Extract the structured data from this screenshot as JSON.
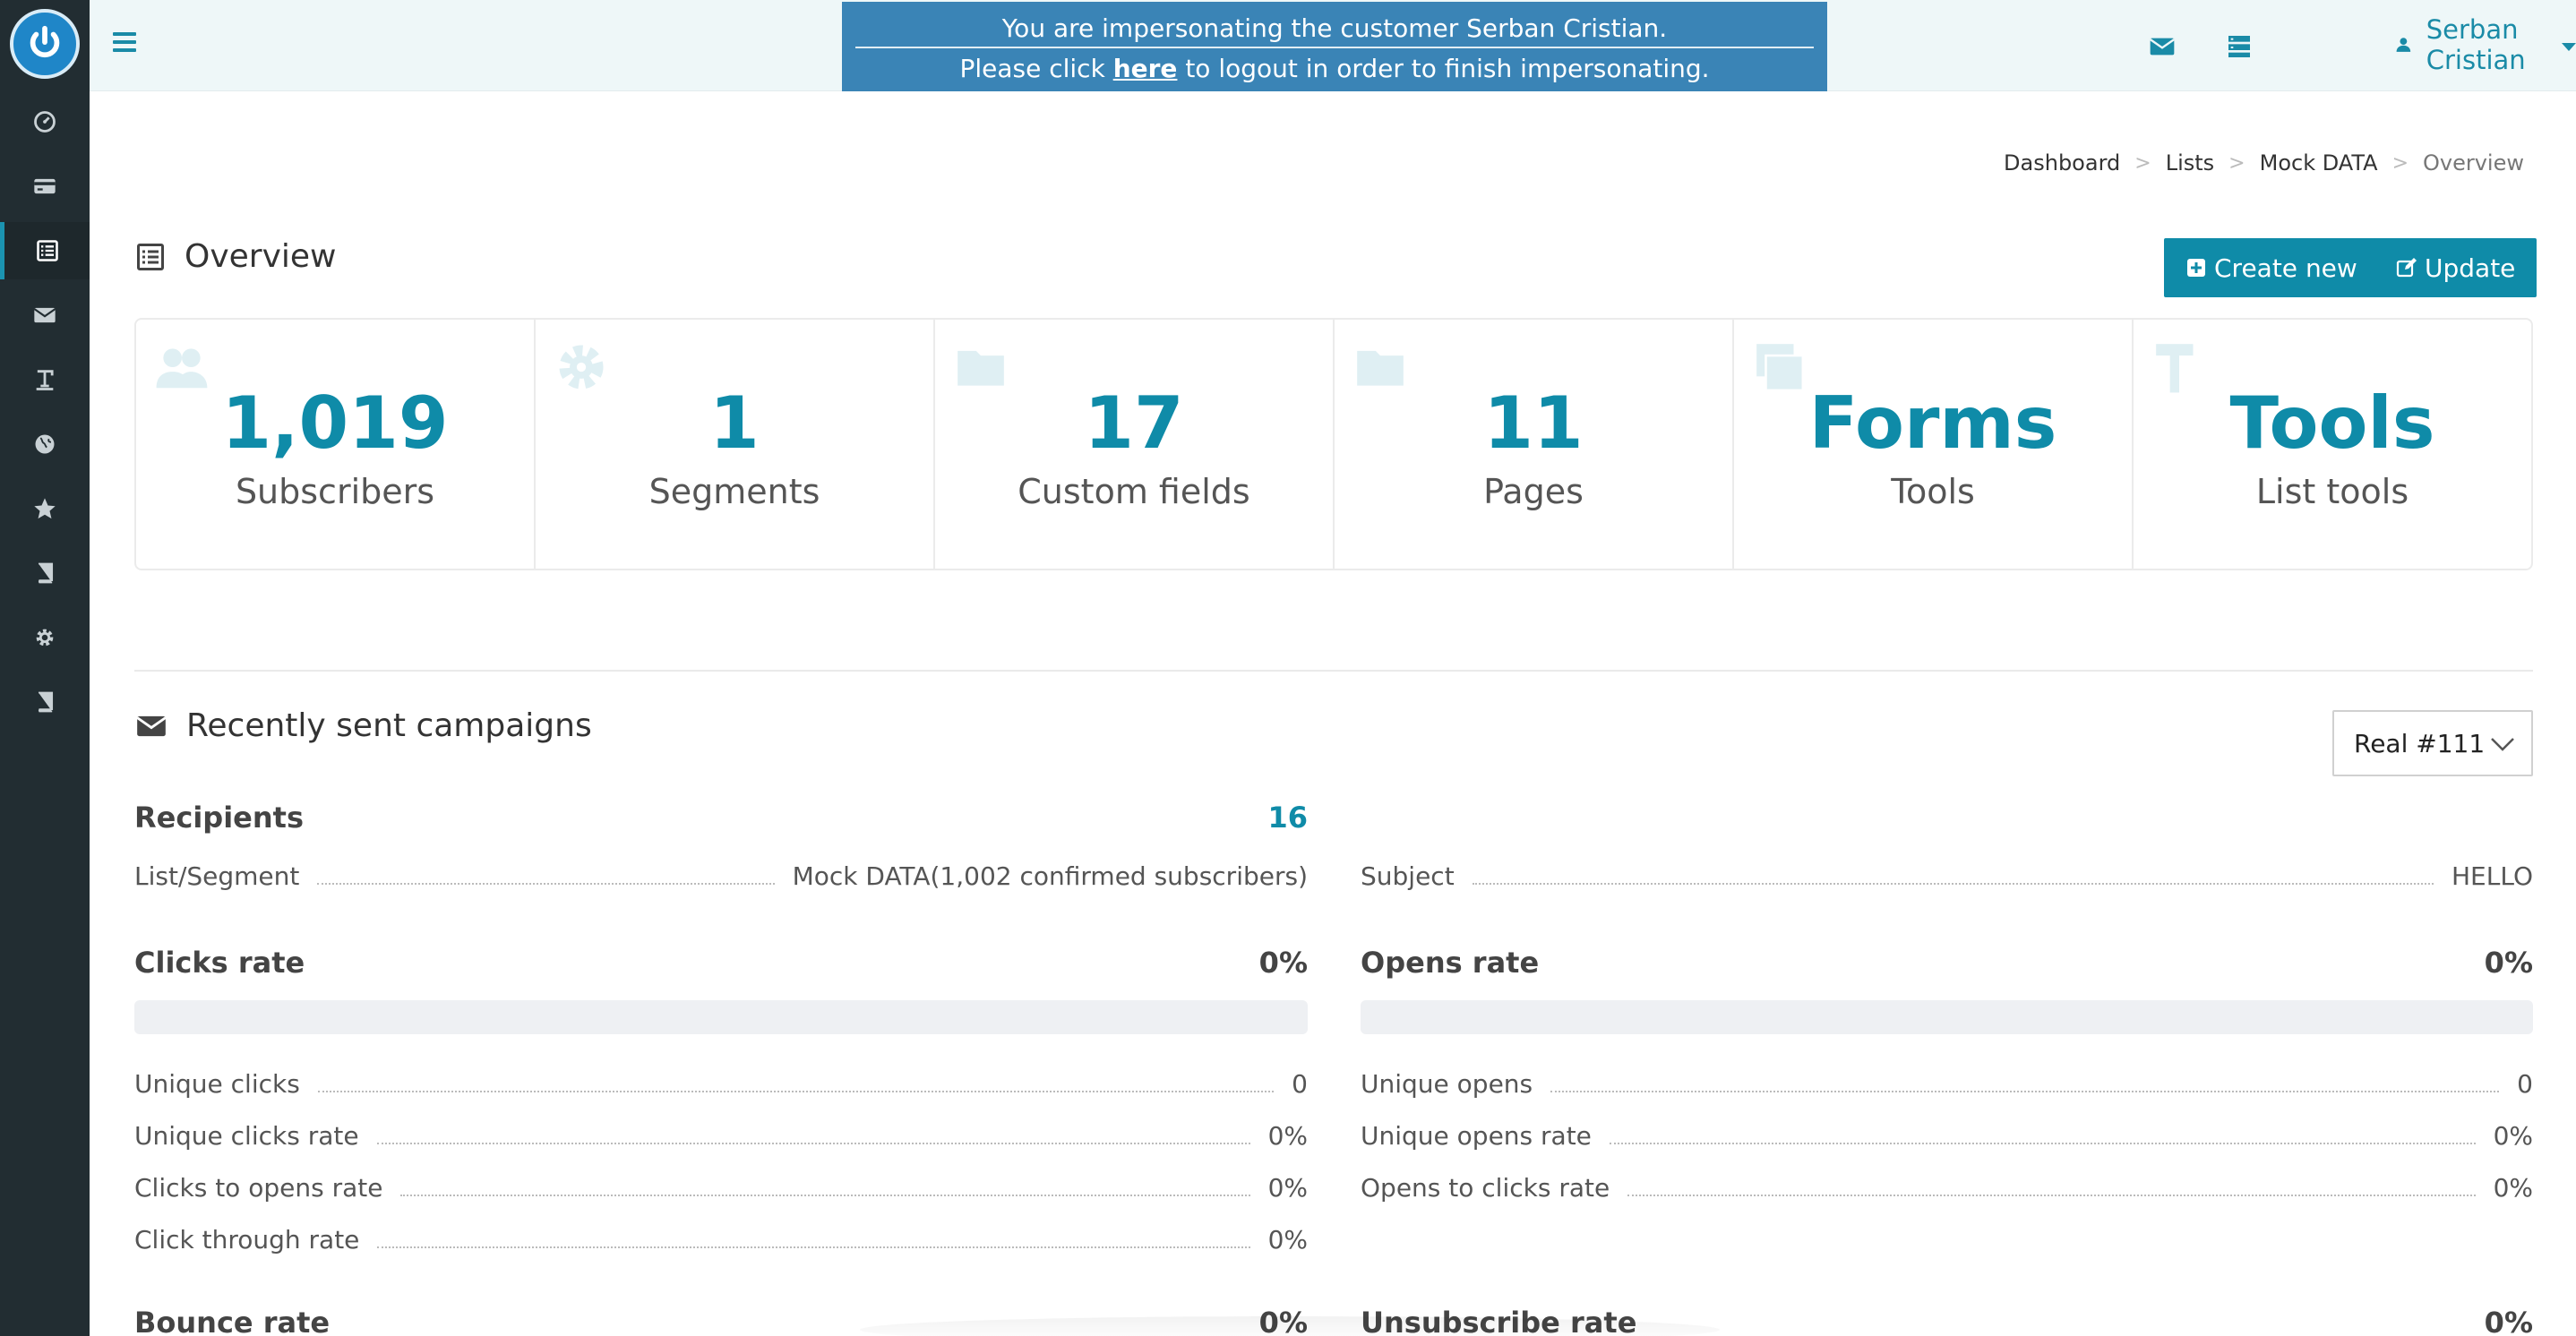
{
  "impersonation": {
    "line1": "You are impersonating the customer Serban Cristian.",
    "line2_pre": "Please click ",
    "line2_link": "here",
    "line2_post": " to logout in order to finish impersonating."
  },
  "header": {
    "user_name": "Serban Cristian"
  },
  "sidebar": {
    "items": [
      {
        "icon": "dashboard-icon"
      },
      {
        "icon": "credit-card-icon"
      },
      {
        "icon": "list-icon",
        "active": true
      },
      {
        "icon": "envelope-icon"
      },
      {
        "icon": "text-icon"
      },
      {
        "icon": "globe-icon"
      },
      {
        "icon": "star-icon"
      },
      {
        "icon": "book-icon"
      },
      {
        "icon": "gear-icon"
      },
      {
        "icon": "book-icon"
      }
    ]
  },
  "breadcrumb": [
    "Dashboard",
    "Lists",
    "Mock DATA",
    "Overview"
  ],
  "overview": {
    "title": "Overview",
    "create_label": "Create new",
    "update_label": "Update",
    "stats": [
      {
        "num": "1,019",
        "label": "Subscribers",
        "icon": "users-icon"
      },
      {
        "num": "1",
        "label": "Segments",
        "icon": "gear-icon"
      },
      {
        "num": "17",
        "label": "Custom fields",
        "icon": "folder-icon"
      },
      {
        "num": "11",
        "label": "Pages",
        "icon": "folder-icon"
      },
      {
        "num": "Forms",
        "label": "Tools",
        "icon": "windows-icon"
      },
      {
        "num": "Tools",
        "label": "List tools",
        "icon": "hammer-icon"
      }
    ]
  },
  "campaigns": {
    "title": "Recently sent campaigns",
    "selected_campaign": "Real #111",
    "recipients_label": "Recipients",
    "recipients_value": "16",
    "list_segment_label": "List/Segment",
    "list_segment_value": "Mock DATA(1,002 confirmed subscribers)",
    "subject_label": "Subject",
    "subject_value": "HELLO",
    "clicks_rate_label": "Clicks rate",
    "clicks_rate_value": "0%",
    "clicks_rate_fraction": 0,
    "opens_rate_label": "Opens rate",
    "opens_rate_value": "0%",
    "opens_rate_fraction": 0,
    "click_rows": [
      {
        "k": "Unique clicks",
        "v": "0"
      },
      {
        "k": "Unique clicks rate",
        "v": "0%"
      },
      {
        "k": "Clicks to opens rate",
        "v": "0%"
      },
      {
        "k": "Click through rate",
        "v": "0%"
      }
    ],
    "open_rows": [
      {
        "k": "Unique opens",
        "v": "0"
      },
      {
        "k": "Unique opens rate",
        "v": "0%"
      },
      {
        "k": "Opens to clicks rate",
        "v": "0%"
      }
    ],
    "bounce_rate_label": "Bounce rate",
    "bounce_rate_value": "0%",
    "unsubscribe_rate_label": "Unsubscribe rate",
    "unsubscribe_rate_value": "0%"
  }
}
